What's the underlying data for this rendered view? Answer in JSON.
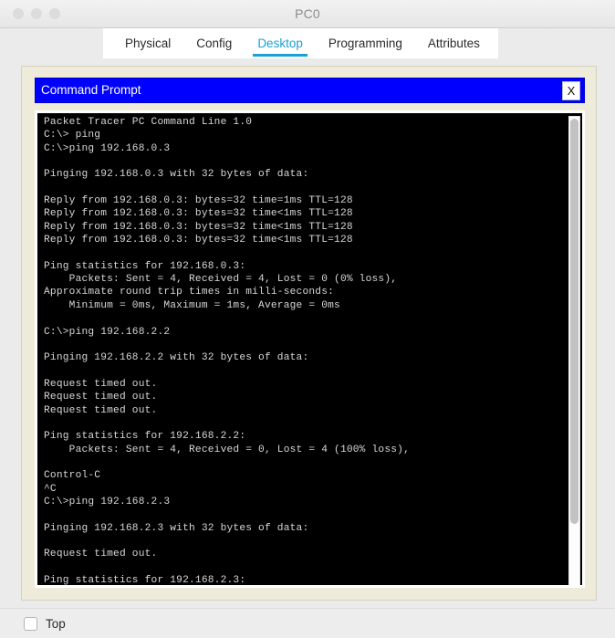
{
  "window": {
    "title": "PC0",
    "traffic_lights": [
      "close",
      "minimize",
      "zoom"
    ]
  },
  "tabs": [
    {
      "label": "Physical",
      "active": false
    },
    {
      "label": "Config",
      "active": false
    },
    {
      "label": "Desktop",
      "active": true
    },
    {
      "label": "Programming",
      "active": false
    },
    {
      "label": "Attributes",
      "active": false
    }
  ],
  "command_prompt": {
    "title": "Command Prompt",
    "close_label": "X",
    "terminal_text": "Packet Tracer PC Command Line 1.0\nC:\\> ping\nC:\\>ping 192.168.0.3\n\nPinging 192.168.0.3 with 32 bytes of data:\n\nReply from 192.168.0.3: bytes=32 time=1ms TTL=128\nReply from 192.168.0.3: bytes=32 time<1ms TTL=128\nReply from 192.168.0.3: bytes=32 time<1ms TTL=128\nReply from 192.168.0.3: bytes=32 time<1ms TTL=128\n\nPing statistics for 192.168.0.3:\n    Packets: Sent = 4, Received = 4, Lost = 0 (0% loss),\nApproximate round trip times in milli-seconds:\n    Minimum = 0ms, Maximum = 1ms, Average = 0ms\n\nC:\\>ping 192.168.2.2\n\nPinging 192.168.2.2 with 32 bytes of data:\n\nRequest timed out.\nRequest timed out.\nRequest timed out.\n\nPing statistics for 192.168.2.2:\n    Packets: Sent = 4, Received = 0, Lost = 4 (100% loss),\n\nControl-C\n^C\nC:\\>ping 192.168.2.3\n\nPinging 192.168.2.3 with 32 bytes of data:\n\nRequest timed out.\n\nPing statistics for 192.168.2.3:"
  },
  "footer": {
    "top_checkbox_label": "Top",
    "top_checkbox_checked": false
  },
  "colors": {
    "titlebar_blue": "#0000ff",
    "active_tab": "#1ba1d4",
    "panel_cream": "#eeebdb",
    "terminal_bg": "#000000",
    "terminal_fg": "#d8d8d8"
  }
}
